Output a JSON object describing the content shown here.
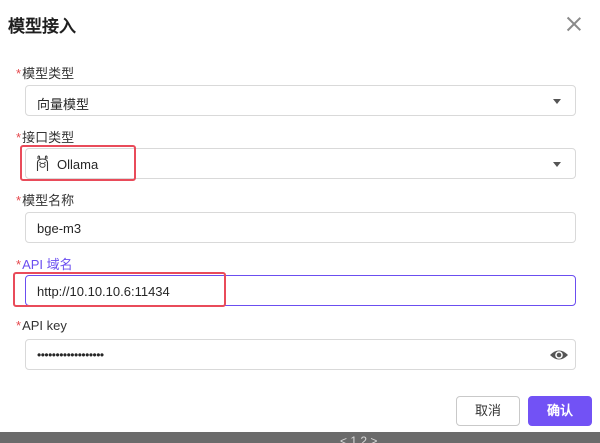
{
  "dialog": {
    "title": "模型接入",
    "close_icon": "close-icon"
  },
  "form": {
    "model_type": {
      "required_mark": "*",
      "label": "模型类型",
      "value": "向量模型"
    },
    "interface_type": {
      "required_mark": "*",
      "label": "接口类型",
      "value": "Ollama",
      "icon": "ollama-icon"
    },
    "model_name": {
      "required_mark": "*",
      "label": "模型名称",
      "value": "bge-m3"
    },
    "api_domain": {
      "required_mark": "*",
      "label": "API 域名",
      "value": "http://10.10.10.6:11434"
    },
    "api_key": {
      "required_mark": "*",
      "label": "API key",
      "value": "••••••••••••••••••",
      "reveal_icon": "eye-icon"
    }
  },
  "footer": {
    "cancel_label": "取消",
    "confirm_label": "确认"
  },
  "backdrop": {
    "pagination_fragment": "< 1 2 >"
  },
  "colors": {
    "accent": "#7252f5",
    "required": "#e5484d",
    "highlight": "#e94b5a"
  }
}
